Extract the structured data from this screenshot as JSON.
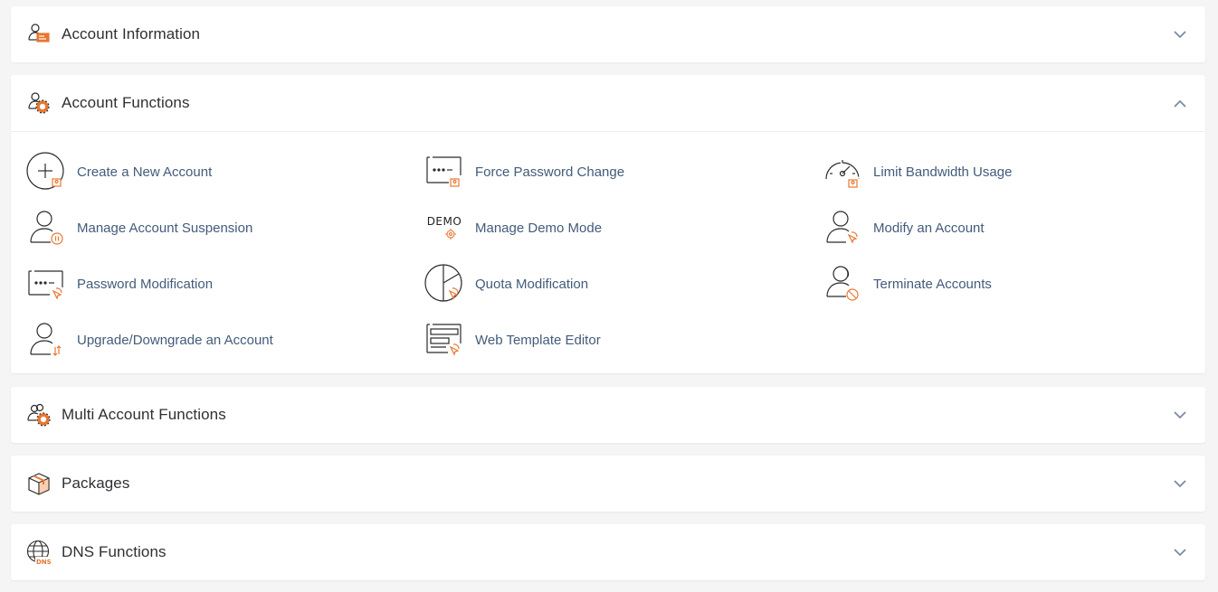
{
  "colors": {
    "accent": "#e87731",
    "link": "#435b7a",
    "icon_stroke": "#2a2a2a",
    "chevron": "#7a8aa6"
  },
  "sections": [
    {
      "title": "Account Information",
      "icon": "account-information-icon",
      "expanded": false
    },
    {
      "title": "Account Functions",
      "icon": "account-functions-icon",
      "expanded": true
    },
    {
      "title": "Multi Account Functions",
      "icon": "multi-account-functions-icon",
      "expanded": false
    },
    {
      "title": "Packages",
      "icon": "package-box-icon",
      "expanded": false
    },
    {
      "title": "DNS Functions",
      "icon": "dns-globe-icon",
      "expanded": false
    }
  ],
  "account_functions": {
    "items": [
      {
        "label": "Create a New Account",
        "icon": "create-account-plus-icon"
      },
      {
        "label": "Force Password Change",
        "icon": "force-password-change-icon"
      },
      {
        "label": "Limit Bandwidth Usage",
        "icon": "bandwidth-gauge-icon"
      },
      {
        "label": "Manage Account Suspension",
        "icon": "account-suspension-icon"
      },
      {
        "label": "Manage Demo Mode",
        "icon": "demo-mode-icon",
        "icon_text": "DEMO"
      },
      {
        "label": "Modify an Account",
        "icon": "modify-account-icon"
      },
      {
        "label": "Password Modification",
        "icon": "password-modification-icon"
      },
      {
        "label": "Quota Modification",
        "icon": "quota-pie-icon"
      },
      {
        "label": "Terminate Accounts",
        "icon": "terminate-accounts-icon"
      },
      {
        "label": "Upgrade/Downgrade an Account",
        "icon": "upgrade-downgrade-icon"
      },
      {
        "label": "Web Template Editor",
        "icon": "web-template-editor-icon"
      }
    ]
  },
  "dns_icon_text": "DNS"
}
